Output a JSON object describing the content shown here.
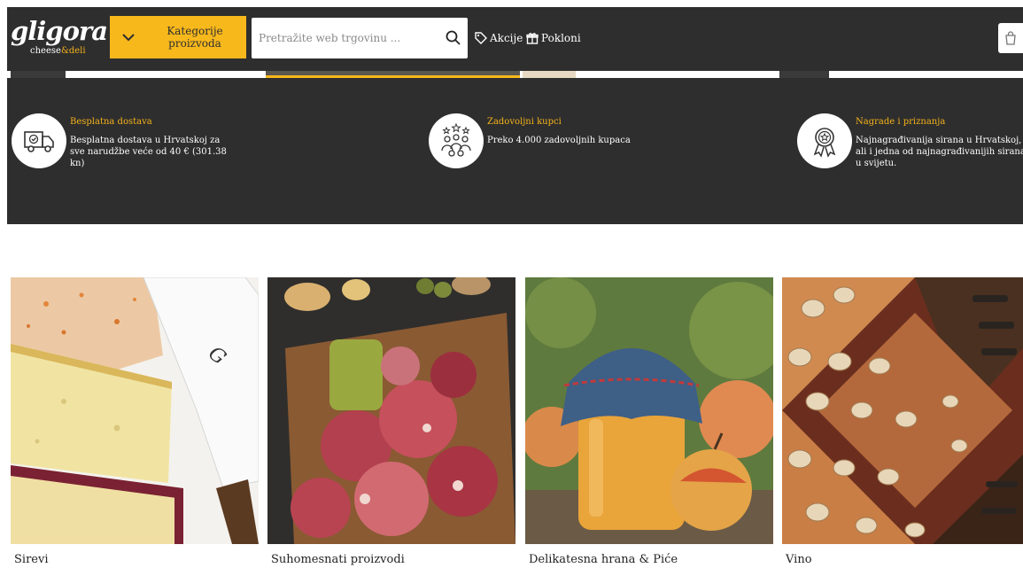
{
  "header": {
    "logo_word": "gligora",
    "logo_tag_a": "cheese",
    "logo_tag_amp": "&",
    "logo_tag_b": "deli",
    "categories_label": "Kategorije proizvoda",
    "search_placeholder": "Pretražite web trgovinu ...",
    "nav": [
      {
        "label": "Akcije",
        "icon": "tag-icon"
      },
      {
        "label": "Pokloni",
        "icon": "gift-icon"
      }
    ],
    "cart_icon": "shopping-bag-icon"
  },
  "features": [
    {
      "title": "Besplatna dostava",
      "text": "Besplatna dostava u Hrvatskoj za sve narudžbe veće od 40 € (301.38 kn)",
      "icon": "delivery-truck-icon"
    },
    {
      "title": "Zadovoljni kupci",
      "text": "Preko 4.000 zadovoljnih kupaca",
      "icon": "customers-group-icon"
    },
    {
      "title": "Nagrade i priznanja",
      "text": "Najnagrađivanija sirana u Hrvatskoj, ali i jedna od najnagrađivanijih sirana u svijetu.",
      "icon": "award-medal-icon"
    }
  ],
  "categories": [
    {
      "label": "Sirevi",
      "image": "cheese-photo"
    },
    {
      "label": "Suhomesnati proizvodi",
      "image": "cured-meat-photo"
    },
    {
      "label": "Delikatesna hrana & Piće",
      "image": "jam-jar-photo"
    },
    {
      "label": "Vino",
      "image": "wine-rack-photo"
    }
  ],
  "colors": {
    "brand_dark": "#2e2e2e",
    "accent_yellow": "#f7b81c",
    "feature_title": "#f5b21b"
  }
}
